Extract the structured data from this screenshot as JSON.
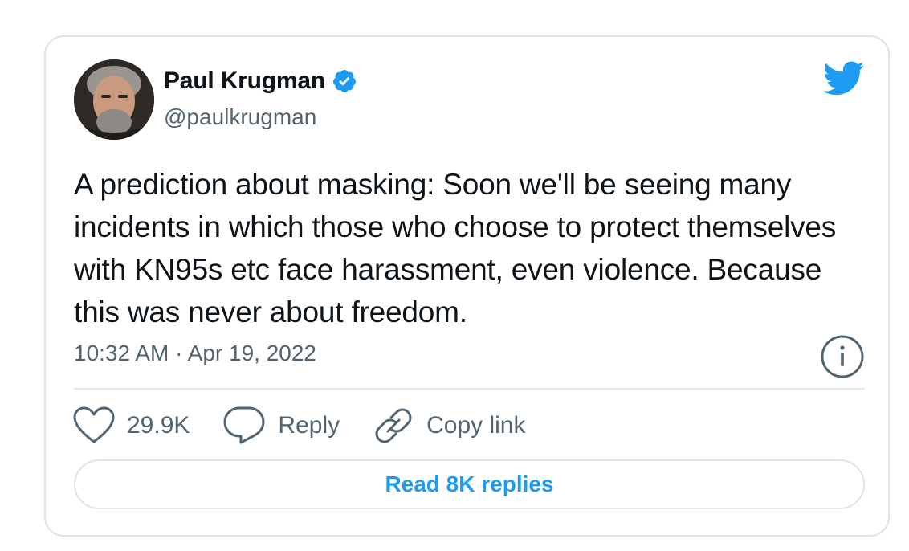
{
  "author": {
    "name": "Paul Krugman",
    "handle": "@paulkrugman",
    "verified": true
  },
  "tweet": {
    "text": "A prediction about masking: Soon we'll be seeing many incidents in which those who choose to protect themselves with KN95s etc face harassment, even violence. Because this was never about freedom.",
    "timestamp": "10:32 AM · Apr 19, 2022"
  },
  "actions": {
    "like_count": "29.9K",
    "reply_label": "Reply",
    "copy_link_label": "Copy link"
  },
  "read_replies_label": "Read 8K replies",
  "icons": {
    "brand": "twitter-bird-icon",
    "verified": "verified-badge-icon",
    "info": "info-icon",
    "like": "heart-icon",
    "reply": "speech-bubble-icon",
    "copy_link": "link-icon"
  },
  "colors": {
    "accent": "#1d9bf0",
    "text_primary": "#0f1419",
    "text_secondary": "#536471",
    "border": "#dfe3e7"
  }
}
